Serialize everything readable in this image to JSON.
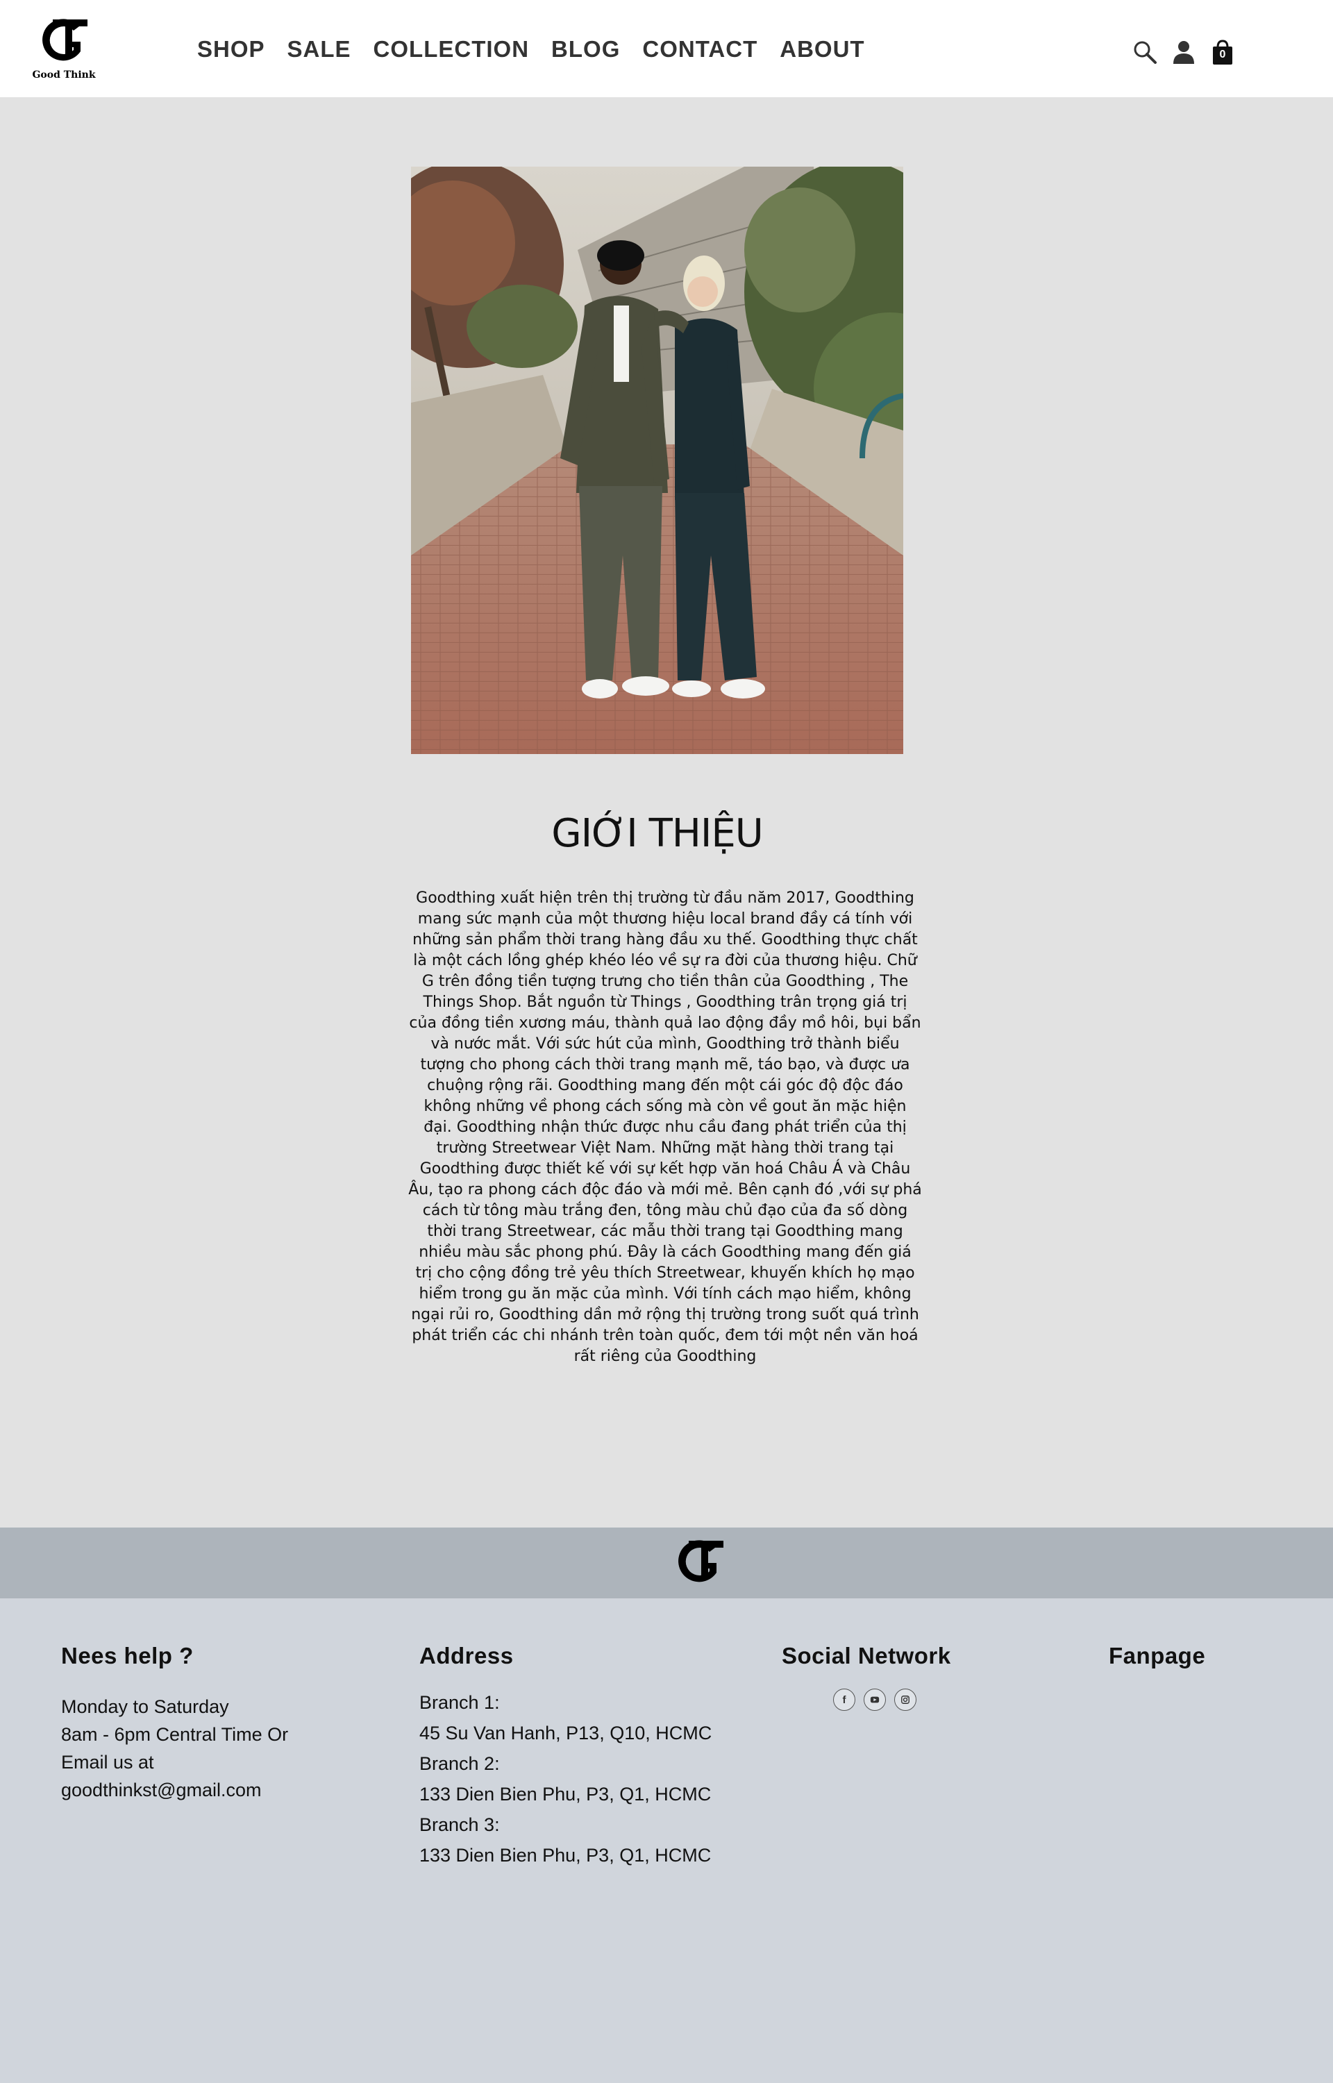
{
  "brand": {
    "logo_text": "Good Think"
  },
  "nav": {
    "items": [
      {
        "label": "SHOP"
      },
      {
        "label": "SALE"
      },
      {
        "label": "COLLECTION"
      },
      {
        "label": "BLOG"
      },
      {
        "label": "CONTACT"
      },
      {
        "label": "ABOUT"
      }
    ]
  },
  "header_actions": {
    "icons": [
      "search-icon",
      "user-icon",
      "shopping-bag-icon"
    ],
    "cart_count": "0"
  },
  "main": {
    "hero_image": "two-models-in-workwear-on-brick-street",
    "title": "GIỚI THIỆU",
    "intro": "Goodthing xuất hiện trên thị trường từ đầu năm 2017, Goodthing mang sức mạnh của một thương hiệu local brand đầy cá tính với những sản phẩm thời trang hàng đầu xu thế. Goodthing thực chất là một cách lồng ghép khéo léo về sự ra đời của thương hiệu. Chữ G trên đồng tiền tượng trưng cho tiền thân của Goodthing , The Things Shop. Bắt nguồn từ Things , Goodthing trân trọng giá trị của đồng tiền xương máu, thành quả lao động đầy mồ hôi, bụi bẩn và nước mắt. Với sức hút của mình, Goodthing  trở thành biểu tượng cho phong cách thời trang mạnh mẽ, táo bạo, và được ưa chuộng rộng rãi. Goodthing mang đến một cái góc độ độc đáo không những về phong cách sống mà còn về gout ăn mặc hiện đại. Goodthing  nhận thức được nhu cầu đang phát triển của thị trường Streetwear Việt Nam. Những mặt hàng thời trang tại Goodthing được thiết kế với sự kết hợp văn hoá Châu Á và Châu Âu, tạo ra phong cách độc đáo và mới mẻ. Bên cạnh đó ,với sự phá cách từ tông màu trắng đen, tông màu chủ đạo của đa số dòng thời trang Streetwear, các mẫu thời trang tại Goodthing mang nhiều màu sắc phong phú. Đây là cách Goodthing mang đến giá trị cho cộng đồng trẻ yêu thích Streetwear, khuyến khích họ mạo hiểm trong gu ăn mặc của mình. Với tính cách mạo hiểm, không ngại rủi ro, Goodthing dần mở rộng thị trường trong suốt quá trình phát triển các chi nhánh trên toàn quốc, đem tới một nền văn hoá rất riêng của Goodthing"
  },
  "footer": {
    "help": {
      "title": "Nees help ?",
      "lines": [
        "Monday to Saturday",
        "8am - 6pm Central Time Or",
        "Email us at",
        "goodthinkst@gmail.com"
      ]
    },
    "address": {
      "title": "Address",
      "lines": [
        "Branch 1:",
        "45 Su Van Hanh, P13, Q10, HCMC",
        "Branch 2:",
        "133 Dien Bien Phu, P3, Q1, HCMC",
        "Branch 3:",
        "133 Dien Bien Phu, P3, Q1, HCMC"
      ]
    },
    "social": {
      "title": "Social Network",
      "icons": [
        "facebook-icon",
        "youtube-icon",
        "instagram-icon"
      ]
    },
    "fanpage": {
      "title": "Fanpage"
    }
  },
  "colors": {
    "header_bg": "#ffffff",
    "page_bg": "#e2e2e2",
    "footer_band": "#adb4bb",
    "footer_bg": "#d0d5dc",
    "nav_text": "#333333"
  }
}
